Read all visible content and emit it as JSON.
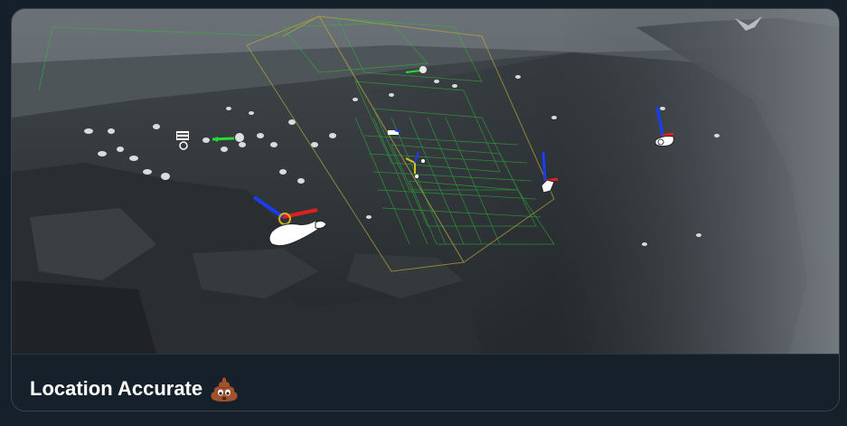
{
  "card": {
    "title": "Location Accurate",
    "title_icon": "pile-of-poo-emoji"
  },
  "media": {
    "description_icon": "scene-image",
    "colors": {
      "sky": "#5a6168",
      "cliff_dark": "#2a2f33",
      "grid_green": "#2fbf3a",
      "bbox_yellow": "#b7a640",
      "gizmo_red": "#e02020",
      "gizmo_blue": "#1a3cff",
      "gizmo_green": "#22dd33"
    }
  }
}
